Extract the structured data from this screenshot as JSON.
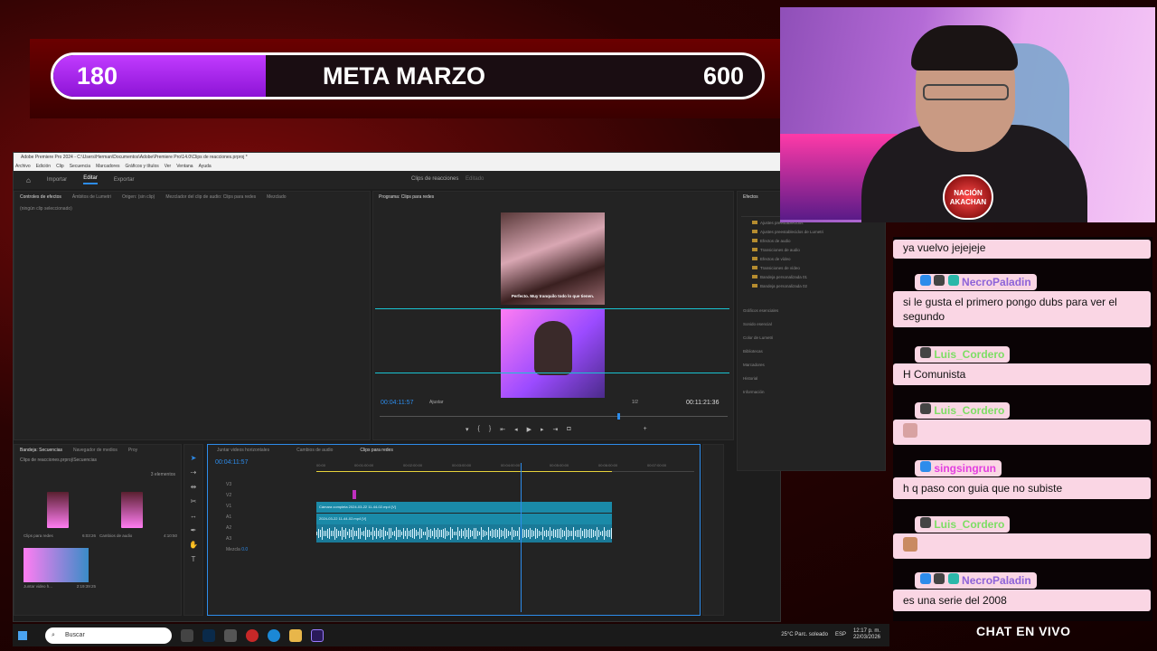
{
  "goal": {
    "current": "180",
    "title": "META MARZO",
    "target": "600",
    "fill_fraction": 0.3
  },
  "premiere": {
    "title_bar": "Adobe Premiere Pro 2024 - C:\\Users\\Herman\\Documentos\\Adobe\\Premiere Pro\\14.0\\Clips de reacciones.prproj *",
    "menu": [
      "Archivo",
      "Edición",
      "Clip",
      "Secuencia",
      "Marcadores",
      "Gráficos y títulos",
      "Ver",
      "Ventana",
      "Ayuda"
    ],
    "workspace_tabs": [
      "Importar",
      "Editar",
      "Exportar"
    ],
    "project_title": "Clips de reacciones",
    "project_status": "Editado",
    "source_tabs": [
      "Controles de efectos",
      "Ámbitos de Lumetri",
      "Origen: (sin clip)",
      "Mezclador del clip de audio: Clips para redes",
      "Mezclado"
    ],
    "no_clip": "(ningún clip seleccionado)",
    "program_tab": "Programa: Clips para redes",
    "subtitle": "Perfecto. Muy tranquilo todo lo que tienen.",
    "timecode_current": "00:04:11:57",
    "fit": "Ajustar",
    "zoom_fraction": "1/2",
    "timecode_total": "00:11:21:36",
    "effects": {
      "title": "Efectos",
      "items": [
        "Ajustes preestablecidos",
        "Ajustes preestablecidos de Lumetri",
        "Efectos de audio",
        "Transiciones de audio",
        "Efectos de vídeo",
        "Transiciones de vídeo",
        "Bandeja personalizada 01",
        "Bandeja personalizada 02"
      ],
      "sections": [
        "Gráficos esenciales",
        "Sonido esencial",
        "Color de Lumetri",
        "Bibliotecas",
        "Marcadores",
        "Historial",
        "Información"
      ]
    },
    "project": {
      "tabs": [
        "Bandeja: Secuencias",
        "Navegador de medios",
        "Proy"
      ],
      "path": "Clips de reacciones.prproj\\Secuencias",
      "count": "3 elementos",
      "items": [
        {
          "name": "Clips para redes",
          "duration": "6:03:26"
        },
        {
          "name": "Cambios de audio",
          "duration": "4:10:50"
        },
        {
          "name": "Juntar video h...",
          "duration": "2:19:39:25"
        }
      ]
    },
    "timeline": {
      "tabs": [
        "Juntar videos horizontales",
        "Cambios de audio",
        "Clips para redes"
      ],
      "timecode": "00:04:11:57",
      "ruler": [
        "00:00",
        "00:01:00:00",
        "00:02:00:00",
        "00:03:00:00",
        "00:04:00:00",
        "00:05:00:00",
        "00:06:00:00",
        "00:07:00:00"
      ],
      "clip_v2": "Cámara completa 2024-03-22 11-44-02.mp4 [V]",
      "clip_v1": "2024-03-22 11-44-02.mp4 [V]",
      "tracks": [
        "V3",
        "V2",
        "V1",
        "A1",
        "A2",
        "A3",
        "Mezcla"
      ],
      "mix_value": "0.0"
    }
  },
  "webcam": {
    "logo_text": "NACIÓN AKACHAN"
  },
  "chat": {
    "title": "CHAT EN VIVO",
    "messages": [
      {
        "user": "",
        "text": "ya vuelvo jejejeje"
      },
      {
        "user": "NecroPaladin",
        "text": "si le gusta el primero pongo dubs para ver el segundo"
      },
      {
        "user": "Luis_Cordero",
        "text": "H Comunista"
      },
      {
        "user": "Luis_Cordero",
        "text": ""
      },
      {
        "user": "singsingrun",
        "text": "h q paso con guia que no subiste"
      },
      {
        "user": "Luis_Cordero",
        "text": ""
      },
      {
        "user": "NecroPaladin",
        "text": "es una serie del 2008"
      }
    ]
  },
  "taskbar": {
    "search_placeholder": "Buscar",
    "weather": "25°C  Parc. soleado",
    "time": "12:17 p. m.",
    "date": "22/03/2026",
    "lang": "ESP"
  },
  "colors": {
    "goal_fill": "#b52cf0",
    "chat_bg": "#fad6e4",
    "accent_blue": "#2d8ceb",
    "clip": "#1a8aa8"
  }
}
